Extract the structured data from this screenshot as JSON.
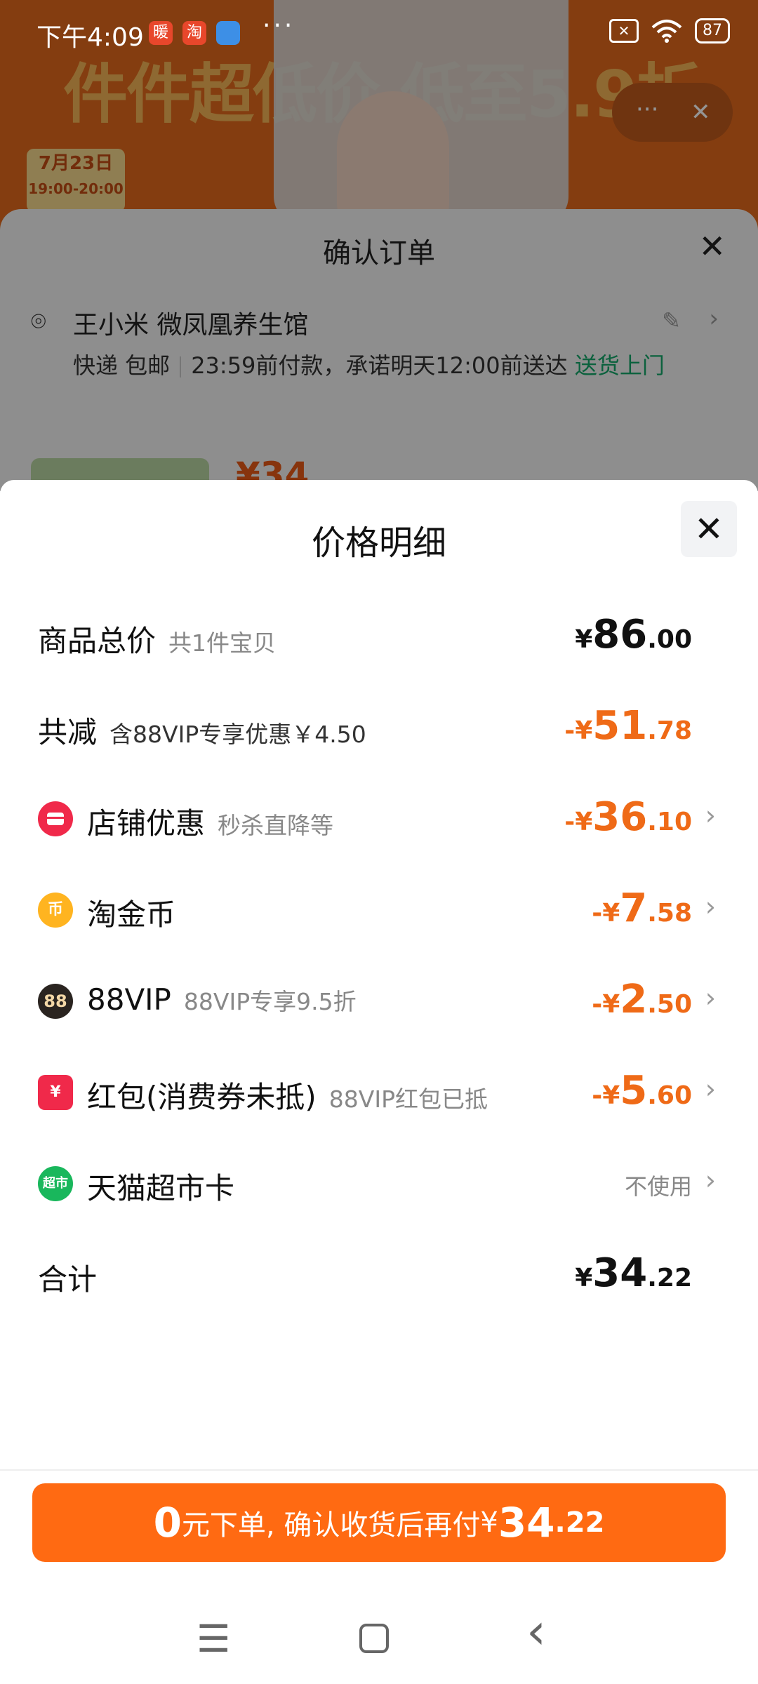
{
  "status_bar": {
    "time": "下午4:09",
    "battery": "87",
    "app_badges": [
      "暖",
      "淘"
    ],
    "more": "···"
  },
  "background": {
    "banner_text": "件件超低价 低至5.9折",
    "date_tag": "7月23日",
    "date_time": "19:00-20:00",
    "more_dots": "···",
    "close_glyph": "✕"
  },
  "order_sheet": {
    "title": "确认订单",
    "name": "王小米 微凤凰养生馆",
    "delivery": "快递 包邮",
    "promise": "23:59前付款，承诺明天12:00前送达",
    "door": "送货上门",
    "price": "¥34",
    "close": "✕"
  },
  "price_detail": {
    "title": "价格明细",
    "close": "✕",
    "rows": [
      {
        "label": "商品总价",
        "note": "共1件宝贝",
        "prefix": "¥",
        "int": "86",
        "dec": ".00",
        "color": "#111111"
      },
      {
        "label": "共减",
        "note": "含88VIP专享优惠￥4.50",
        "prefix": "-¥",
        "int": "51",
        "dec": ".78",
        "color": "#ef6a17"
      },
      {
        "icon": "store-icon",
        "label": "店铺优惠",
        "note": "秒杀直降等",
        "prefix": "-¥",
        "int": "36",
        "dec": ".10",
        "color": "#ef6a17"
      },
      {
        "icon": "coin-icon",
        "label": "淘金币",
        "note": "",
        "prefix": "-¥",
        "int": "7",
        "dec": ".58",
        "color": "#ef6a17"
      },
      {
        "icon": "vip88-icon",
        "label": "88VIP",
        "note": "88VIP专享9.5折",
        "prefix": "-¥",
        "int": "2",
        "dec": ".50",
        "color": "#ef6a17"
      },
      {
        "icon": "redpacket-icon",
        "label": "红包(消费券未抵)",
        "note": "88VIP红包已抵",
        "prefix": "-¥",
        "int": "5",
        "dec": ".60",
        "color": "#ef6a17"
      },
      {
        "icon": "supermarket-icon",
        "label": "天猫超市卡",
        "note": "",
        "value": "不使用"
      },
      {
        "label": "合计",
        "note": "",
        "prefix": "¥",
        "int": "34",
        "dec": ".22",
        "color": "#111111"
      }
    ],
    "icon_glyphs": {
      "coin": "币",
      "vip88": "88",
      "redpacket": "¥",
      "supermarket": "超市"
    }
  },
  "pay_button": {
    "zero": "0",
    "text": "元下单, 确认收货后再付",
    "sym": "¥",
    "int": "34",
    "dec": ".22"
  },
  "nav": {
    "menu": "☰",
    "home": "□",
    "back": "‹"
  }
}
